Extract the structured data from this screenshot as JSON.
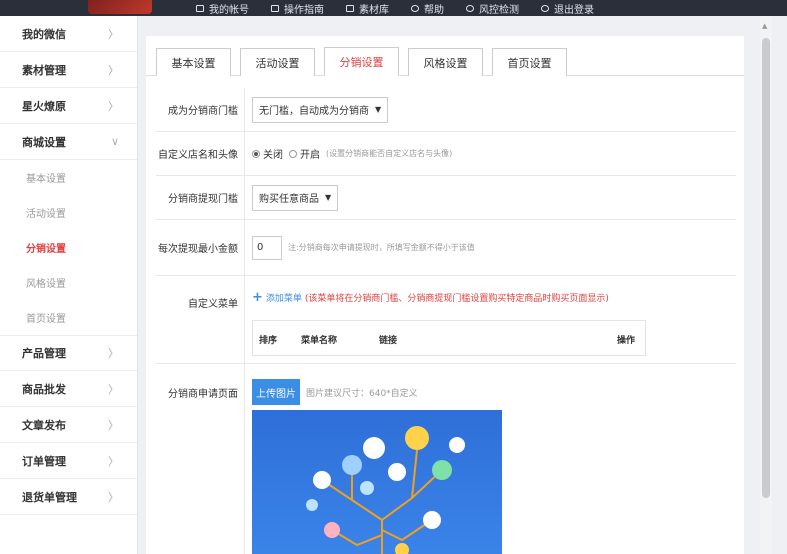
{
  "topnav": {
    "items": [
      {
        "label": "我的帐号",
        "icon": "user-icon"
      },
      {
        "label": "操作指南",
        "icon": "book-icon"
      },
      {
        "label": "素材库",
        "icon": "folder-icon"
      },
      {
        "label": "帮助",
        "icon": "help-icon"
      },
      {
        "label": "风控检测",
        "icon": "shield-icon"
      },
      {
        "label": "退出登录",
        "icon": "logout-icon"
      }
    ]
  },
  "sidebar": {
    "items": [
      {
        "label": "我的微信",
        "chev": "〉"
      },
      {
        "label": "素材管理",
        "chev": "〉"
      },
      {
        "label": "星火燎原",
        "chev": "〉"
      },
      {
        "label": "商城设置",
        "chev": "∨"
      }
    ],
    "sub_items": [
      "基本设置",
      "活动设置",
      "分销设置",
      "风格设置",
      "首页设置"
    ],
    "items_after": [
      {
        "label": "产品管理",
        "chev": "〉"
      },
      {
        "label": "商品批发",
        "chev": "〉"
      },
      {
        "label": "文章发布",
        "chev": "〉"
      },
      {
        "label": "订单管理",
        "chev": "〉"
      },
      {
        "label": "退货单管理",
        "chev": "〉"
      }
    ]
  },
  "tabs": [
    "基本设置",
    "活动设置",
    "分销设置",
    "风格设置",
    "首页设置"
  ],
  "form": {
    "threshold": {
      "label": "成为分销商门槛",
      "value": "无门槛，自动成为分销商"
    },
    "custom_store": {
      "label": "自定义店名和头像",
      "opt_off": "关闭",
      "opt_on": "开启",
      "hint": "(设置分销商能否自定义店名与头像)"
    },
    "withdraw": {
      "label": "分销商提现门槛",
      "value": "购买任意商品"
    },
    "min_amount": {
      "label": "每次提现最小金额",
      "value": "0",
      "hint": "注:分销商每次申请提现时，所填写金额不得小于该值"
    },
    "custom_menu": {
      "label": "自定义菜单",
      "add_text": "添加菜单",
      "warning": "(该菜单将在分销商门槛、分销商提现门槛设置购买特定商品时购买页面显示)",
      "headers": [
        "排序",
        "菜单名称",
        "链接",
        "操作"
      ]
    },
    "apply_page": {
      "label": "分销商申请页面",
      "upload_label": "上传图片",
      "hint": "图片建议尺寸：640*自定义"
    }
  },
  "colors": {
    "accent": "#3a8ee6",
    "active": "#e04040"
  }
}
